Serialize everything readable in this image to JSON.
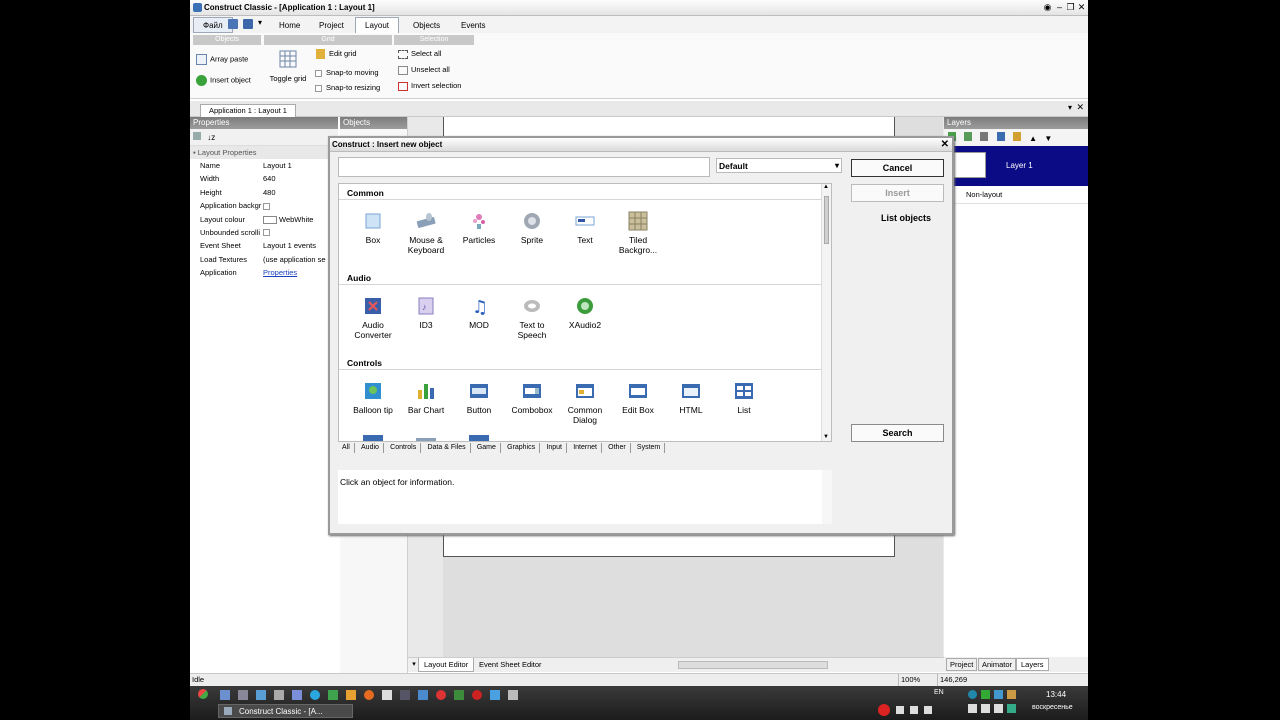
{
  "window": {
    "title": "Construct Classic - [Application 1 : Layout 1]"
  },
  "ribbon": {
    "file_label": "Файл",
    "tabs": [
      "Home",
      "Project",
      "Layout",
      "Objects",
      "Events"
    ],
    "active_tab": "Layout",
    "groups": {
      "objects": "Objects",
      "grid": "Grid",
      "selection": "Selection"
    },
    "array_paste": "Array paste",
    "insert_object": "Insert object",
    "toggle_grid": "Toggle grid",
    "edit_grid": "Edit grid",
    "snap_moving": "Snap-to moving",
    "snap_resizing": "Snap-to resizing",
    "select_all": "Select all",
    "unselect_all": "Unselect all",
    "invert_selection": "Invert selection"
  },
  "doc_tab": "Application 1 : Layout 1",
  "properties": {
    "header": "Properties",
    "section": "Layout Properties",
    "rows": [
      {
        "k": "Name",
        "v": "Layout 1"
      },
      {
        "k": "Width",
        "v": "640"
      },
      {
        "k": "Height",
        "v": "480"
      },
      {
        "k": "Application backgr",
        "v": ""
      },
      {
        "k": "Layout colour",
        "v": "WebWhite"
      },
      {
        "k": "Unbounded scrolli",
        "v": ""
      },
      {
        "k": "Event Sheet",
        "v": "Layout 1 events"
      },
      {
        "k": "Load Textures",
        "v": "(use application se"
      },
      {
        "k": "Application",
        "v": "Properties"
      }
    ]
  },
  "objects_panel": {
    "header": "Objects"
  },
  "layers_panel": {
    "header": "Layers",
    "layer_name": "Layer 1",
    "non_layout": "Non-layout"
  },
  "dialog": {
    "title": "Construct : Insert new object",
    "search_value": "",
    "dropdown_value": "Default",
    "cancel": "Cancel",
    "insert": "Insert",
    "list_objects": "List objects",
    "search": "Search",
    "info": "Click an object for information.",
    "sections": [
      {
        "name": "Common",
        "items": [
          "Box",
          "Mouse & Keyboard",
          "Particles",
          "Sprite",
          "Text",
          "Tiled Backgro..."
        ]
      },
      {
        "name": "Audio",
        "items": [
          "Audio Converter",
          "ID3",
          "MOD",
          "Text to Speech",
          "XAudio2"
        ]
      },
      {
        "name": "Controls",
        "items": [
          "Balloon tip",
          "Bar Chart",
          "Button",
          "Combobox",
          "Common Dialog",
          "Edit Box",
          "HTML",
          "List"
        ]
      }
    ],
    "categories": [
      "All",
      "Audio",
      "Controls",
      "Data & Files",
      "Game",
      "Graphics",
      "Input",
      "Internet",
      "Other",
      "System"
    ]
  },
  "bottom_tabs": {
    "layout_editor": "Layout Editor",
    "event_sheet_editor": "Event Sheet Editor"
  },
  "right_tabs": [
    "Project",
    "Animator",
    "Layers"
  ],
  "status": {
    "state": "Idle",
    "zoom": "100%",
    "coords": "146,269"
  },
  "taskbar": {
    "app_button": "Construct Classic - [A...",
    "lang": "EN",
    "time": "13:44",
    "day": "воскресенье"
  }
}
